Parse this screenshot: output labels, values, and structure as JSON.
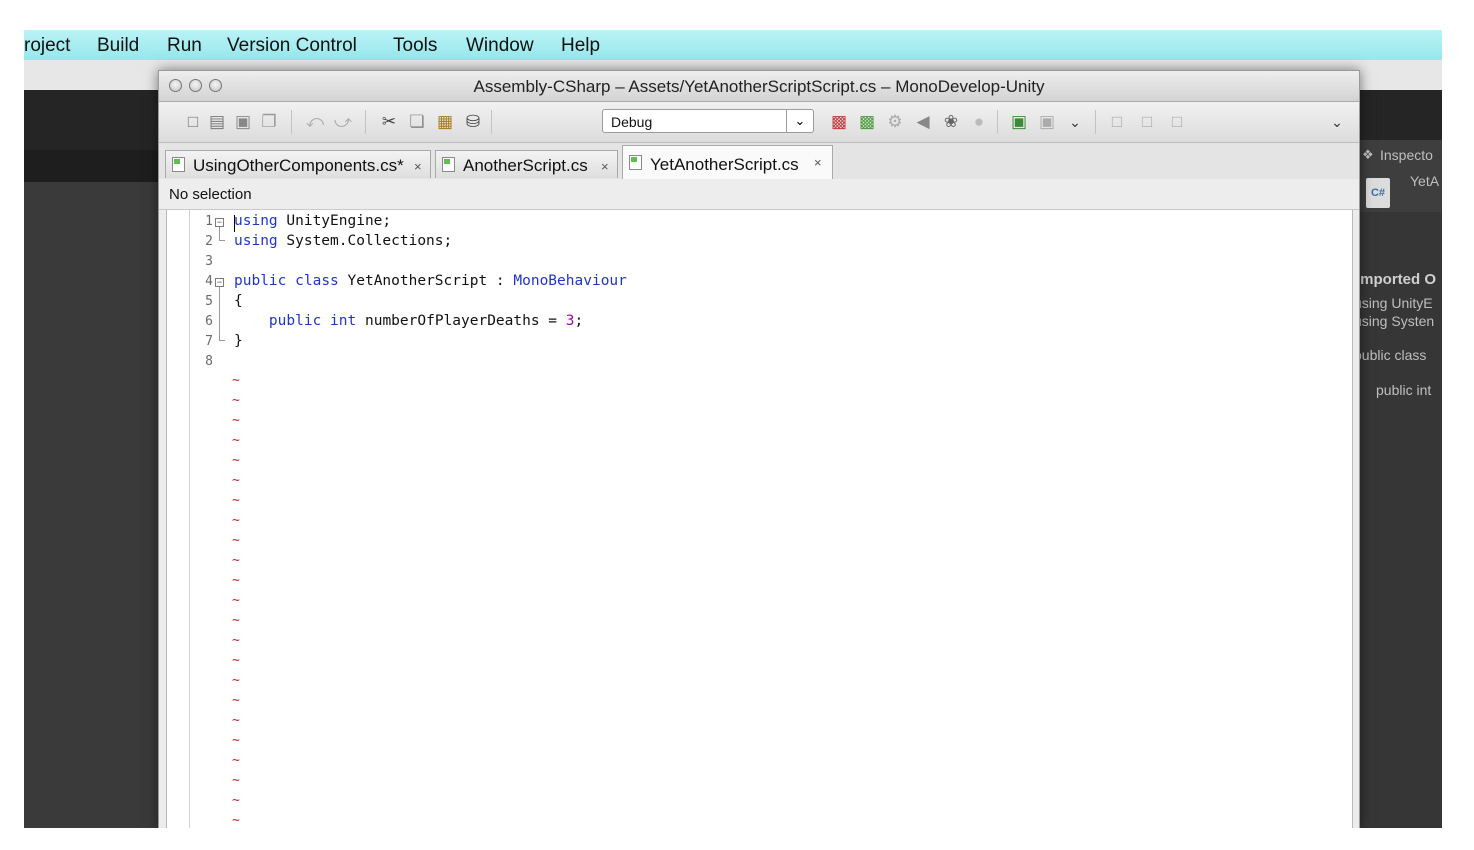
{
  "menubar": {
    "items": [
      "roject",
      "Build",
      "Run",
      "Version Control",
      "Tools",
      "Window",
      "Help"
    ]
  },
  "window": {
    "title": "Assembly-CSharp – Assets/YetAnotherScriptScript.cs – MonoDevelop-Unity"
  },
  "toolbar": {
    "config_value": "Debug",
    "icons": [
      "new-file-icon",
      "open-file-icon",
      "save-icon",
      "save-all-icon",
      "undo-icon",
      "redo-icon",
      "cut-icon",
      "copy-icon",
      "paste-icon",
      "database-icon",
      "build-icon",
      "rebuild-icon",
      "run-icon",
      "attach-icon",
      "stop-icon",
      "navigate-back-icon",
      "navigate-forward-icon",
      "chevron-down-icon",
      "layout-icon",
      "layout-icon-2",
      "layout-icon-3",
      "chevron-down-icon-2"
    ]
  },
  "tabs": [
    {
      "label": "UsingOtherComponents.cs*",
      "close": "×"
    },
    {
      "label": "AnotherScript.cs",
      "close": "×"
    },
    {
      "label": "YetAnotherScript.cs",
      "close": "×",
      "active": true
    }
  ],
  "selection_bar": {
    "text": "No selection"
  },
  "editor": {
    "line_numbers": [
      "1",
      "2",
      "3",
      "4",
      "5",
      "6",
      "7",
      "8"
    ],
    "lines": [
      {
        "kw": "using",
        "rest": " UnityEngine;"
      },
      {
        "kw": "using",
        "rest": " System.Collections;"
      },
      {
        "text": ""
      },
      {
        "kw": "public",
        "kw2": "class",
        "name": " YetAnotherScript : ",
        "type": "MonoBehaviour"
      },
      {
        "text": "{"
      },
      {
        "indent": "    ",
        "kw": "public",
        "kw2": "int",
        "name": " numberOfPlayerDeaths = ",
        "num": "3",
        "tail": ";"
      },
      {
        "text": "}"
      },
      {
        "text": ""
      }
    ],
    "tilde": "~"
  },
  "inspector": {
    "title": "Inspecto",
    "script_name": "YetA",
    "file_badge": "C#",
    "imported_label": "Imported O",
    "code_lines": [
      "using UnityE",
      "using Systen",
      "public class",
      "public int"
    ]
  },
  "colors": {
    "keyword": "#1f35c9",
    "number": "#9c0aa6",
    "tilde": "#c2262e",
    "menubar": "#a8eef2"
  }
}
